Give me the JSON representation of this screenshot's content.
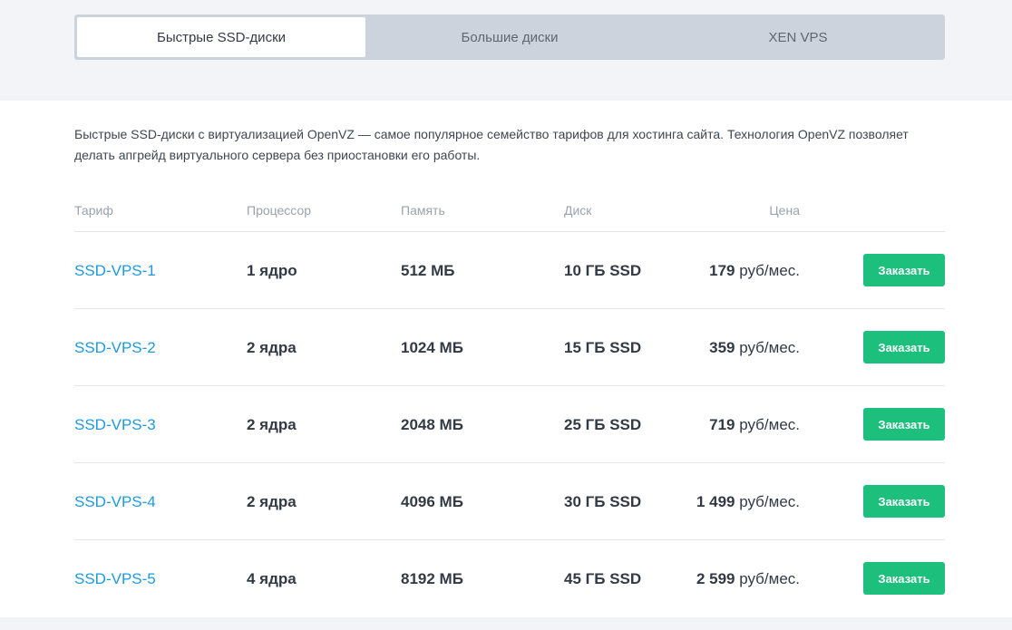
{
  "tabs": [
    {
      "label": "Быстрые SSD-диски",
      "active": true
    },
    {
      "label": "Большие диски",
      "active": false
    },
    {
      "label": "XEN VPS",
      "active": false
    }
  ],
  "description": "Быстрые SSD-диски с виртуализацией OpenVZ — самое популярное семейство тарифов для хостинга сайта. Технология OpenVZ позволяет делать апгрейд виртуального сервера без приостановки его работы.",
  "table": {
    "headers": {
      "tariff": "Тариф",
      "cpu": "Процессор",
      "memory": "Память",
      "disk": "Диск",
      "price": "Цена"
    },
    "price_unit": "руб/мес.",
    "order_label": "Заказать",
    "rows": [
      {
        "name": "SSD-VPS-1",
        "cpu": "1 ядро",
        "memory": "512 МБ",
        "disk": "10 ГБ SSD",
        "price": "179"
      },
      {
        "name": "SSD-VPS-2",
        "cpu": "2 ядра",
        "memory": "1024 МБ",
        "disk": "15 ГБ SSD",
        "price": "359"
      },
      {
        "name": "SSD-VPS-3",
        "cpu": "2 ядра",
        "memory": "2048 МБ",
        "disk": "25 ГБ SSD",
        "price": "719"
      },
      {
        "name": "SSD-VPS-4",
        "cpu": "2 ядра",
        "memory": "4096 МБ",
        "disk": "30 ГБ SSD",
        "price": "1 499"
      },
      {
        "name": "SSD-VPS-5",
        "cpu": "4 ядра",
        "memory": "8192 МБ",
        "disk": "45 ГБ SSD",
        "price": "2 599"
      }
    ]
  },
  "colors": {
    "accent_link": "#1e9ae0",
    "order_button": "#1cbf7c",
    "tab_bar": "#cdd3dd"
  }
}
